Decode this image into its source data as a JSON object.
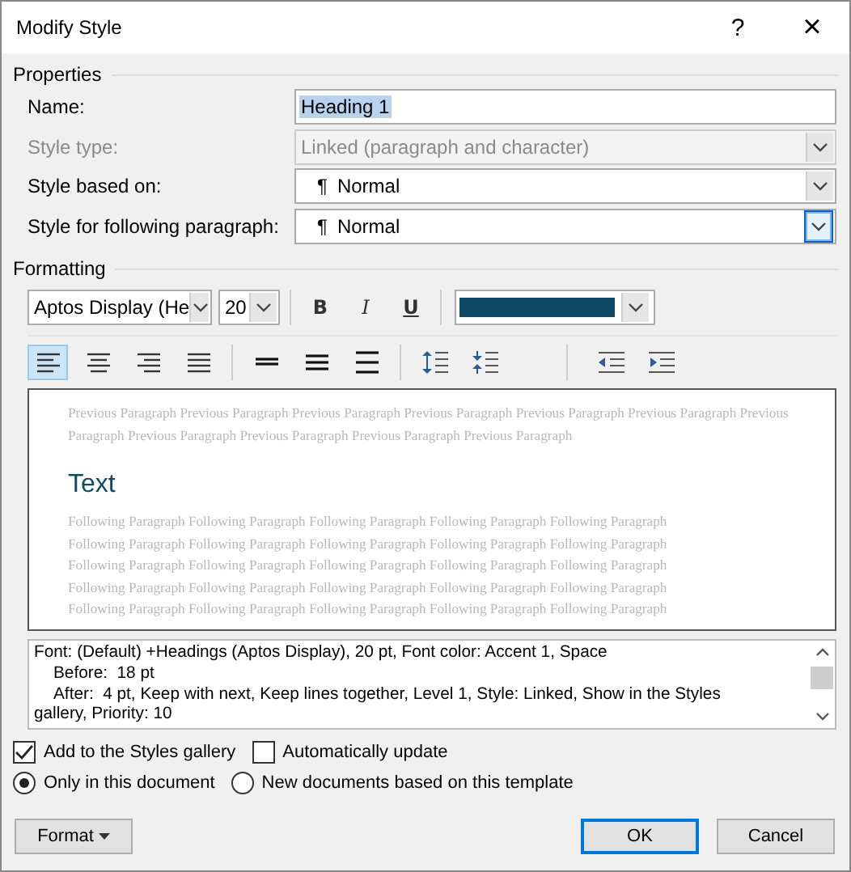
{
  "window": {
    "title": "Modify Style",
    "help": "?",
    "close": "×"
  },
  "properties": {
    "heading": "Properties",
    "fields": [
      {
        "label": "Name:",
        "kind": "text",
        "value": "Heading 1",
        "selected_text": true
      },
      {
        "label": "Style type:",
        "kind": "dropdown",
        "value": "Linked (paragraph and character)",
        "disabled": true,
        "focused": false
      },
      {
        "label": "Style based on:",
        "kind": "dropdown",
        "mark": "¶",
        "value": "Normal",
        "disabled": false,
        "focused": false
      },
      {
        "label": "Style for following paragraph:",
        "kind": "dropdown",
        "mark": "¶",
        "value": "Normal",
        "disabled": false,
        "focused": true
      }
    ]
  },
  "formatting": {
    "heading": "Formatting",
    "font": "Aptos Display (He",
    "size": "20",
    "styles": [
      {
        "label": "B",
        "kind": "bold",
        "selected": false
      },
      {
        "label": "I",
        "kind": "italic",
        "selected": false
      },
      {
        "label": "U",
        "kind": "underline",
        "selected": false
      }
    ],
    "font_color": {
      "color": "#0e4a63"
    },
    "paragraph_buttons": [
      {
        "kind": "align-left",
        "selected": true
      },
      {
        "kind": "align-center",
        "selected": false
      },
      {
        "kind": "align-right",
        "selected": false
      },
      {
        "kind": "justify",
        "selected": false
      },
      {
        "kind": "single-spacing",
        "selected": false
      },
      {
        "kind": "one-half-spacing",
        "selected": false
      },
      {
        "kind": "double-spacing",
        "selected": false
      },
      {
        "kind": "increase-spacing",
        "selected": false
      },
      {
        "kind": "decrease-spacing",
        "selected": false
      },
      {
        "kind": "decrease-indent",
        "selected": false
      },
      {
        "kind": "increase-indent",
        "selected": false
      }
    ]
  },
  "preview": {
    "previous_lines": [
      "Previous Paragraph Previous Paragraph Previous Paragraph Previous Paragraph Previous Paragraph Previous Paragraph Previous",
      "Paragraph Previous Paragraph Previous Paragraph Previous Paragraph Previous Paragraph"
    ],
    "sample": "Text",
    "following_lines": [
      "Following Paragraph Following Paragraph Following Paragraph Following Paragraph Following Paragraph",
      "Following Paragraph Following Paragraph Following Paragraph Following Paragraph Following Paragraph",
      "Following Paragraph Following Paragraph Following Paragraph Following Paragraph Following Paragraph",
      "Following Paragraph Following Paragraph Following Paragraph Following Paragraph Following Paragraph",
      "Following Paragraph Following Paragraph Following Paragraph Following Paragraph Following Paragraph"
    ]
  },
  "description": [
    "Font: (Default) +Headings (Aptos Display), 20 pt, Font color: Accent 1, Space",
    "Before:  18 pt",
    "After:  4 pt, Keep with next, Keep lines together, Level 1, Style: Linked, Show in the Styles",
    "gallery, Priority: 10"
  ],
  "checkboxes": [
    {
      "label": "Add to the Styles gallery",
      "checked": true
    },
    {
      "label": "Automatically update",
      "checked": false
    }
  ],
  "radios": [
    {
      "label": "Only in this document",
      "selected": true
    },
    {
      "label": "New documents based on this template",
      "selected": false
    }
  ],
  "buttons": [
    {
      "label": "Format",
      "kind": "menu",
      "default": false
    },
    {
      "label": "OK",
      "kind": "ok",
      "default": true
    },
    {
      "label": "Cancel",
      "kind": "cancel",
      "default": false
    }
  ]
}
